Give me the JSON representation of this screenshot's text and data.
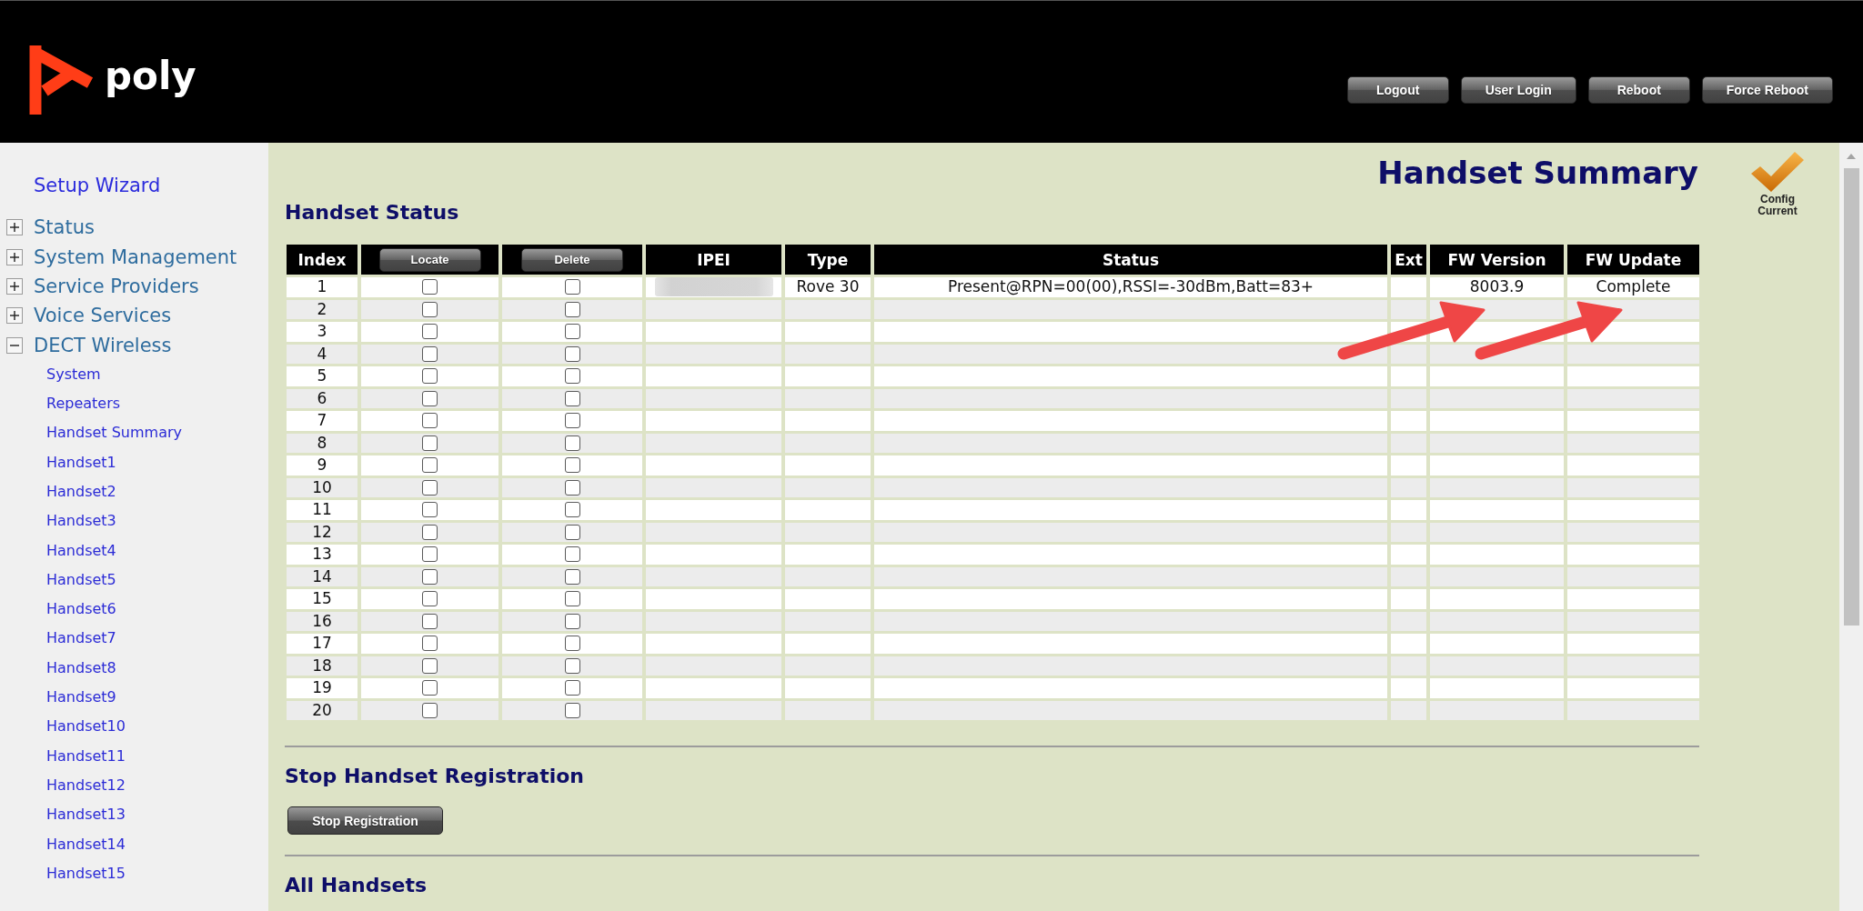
{
  "header": {
    "logo_text": "poly",
    "buttons": [
      "Logout",
      "User Login",
      "Reboot",
      "Force Reboot"
    ]
  },
  "sidebar": {
    "top_link": "Setup Wizard",
    "items": [
      {
        "label": "Status",
        "expanded": false
      },
      {
        "label": "System Management",
        "expanded": false
      },
      {
        "label": "Service Providers",
        "expanded": false
      },
      {
        "label": "Voice Services",
        "expanded": false
      },
      {
        "label": "DECT Wireless",
        "expanded": true,
        "children": [
          {
            "label": "System"
          },
          {
            "label": "Repeaters"
          },
          {
            "label": "Handset Summary"
          },
          {
            "label": "Handset1"
          },
          {
            "label": "Handset2"
          },
          {
            "label": "Handset3"
          },
          {
            "label": "Handset4"
          },
          {
            "label": "Handset5"
          },
          {
            "label": "Handset6"
          },
          {
            "label": "Handset7"
          },
          {
            "label": "Handset8"
          },
          {
            "label": "Handset9"
          },
          {
            "label": "Handset10"
          },
          {
            "label": "Handset11"
          },
          {
            "label": "Handset12"
          },
          {
            "label": "Handset13"
          },
          {
            "label": "Handset14"
          },
          {
            "label": "Handset15"
          }
        ]
      }
    ]
  },
  "page_title": "Handset Summary",
  "config_status": "Config Current",
  "handset_status": {
    "heading": "Handset Status",
    "columns": [
      {
        "label": "Index",
        "kind": "text",
        "marked_by_arrow": false
      },
      {
        "label": "Locate",
        "kind": "button",
        "marked_by_arrow": false
      },
      {
        "label": "Delete",
        "kind": "button",
        "marked_by_arrow": false
      },
      {
        "label": "IPEI",
        "kind": "text",
        "marked_by_arrow": false
      },
      {
        "label": "Type",
        "kind": "text",
        "marked_by_arrow": false
      },
      {
        "label": "Status",
        "kind": "text",
        "marked_by_arrow": false
      },
      {
        "label": "Ext",
        "kind": "text",
        "marked_by_arrow": false
      },
      {
        "label": "FW Version",
        "kind": "text",
        "marked_by_arrow": true
      },
      {
        "label": "FW Update",
        "kind": "text",
        "marked_by_arrow": true
      }
    ],
    "rows": [
      {
        "index": "1",
        "locate_checked": false,
        "delete_checked": false,
        "ipei_redacted": true,
        "type": "Rove 30",
        "status": "Present@RPN=00(00),RSSI=-30dBm,Batt=83+",
        "fw_version": "8003.9",
        "fw_update": "Complete"
      },
      {
        "index": "2",
        "locate_checked": false,
        "delete_checked": false,
        "ipei_redacted": false
      },
      {
        "index": "3",
        "locate_checked": false,
        "delete_checked": false,
        "ipei_redacted": false
      },
      {
        "index": "4",
        "locate_checked": false,
        "delete_checked": false,
        "ipei_redacted": false
      },
      {
        "index": "5",
        "locate_checked": false,
        "delete_checked": false,
        "ipei_redacted": false
      },
      {
        "index": "6",
        "locate_checked": false,
        "delete_checked": false,
        "ipei_redacted": false
      },
      {
        "index": "7",
        "locate_checked": false,
        "delete_checked": false,
        "ipei_redacted": false
      },
      {
        "index": "8",
        "locate_checked": false,
        "delete_checked": false,
        "ipei_redacted": false
      },
      {
        "index": "9",
        "locate_checked": false,
        "delete_checked": false,
        "ipei_redacted": false
      },
      {
        "index": "10",
        "locate_checked": false,
        "delete_checked": false,
        "ipei_redacted": false
      },
      {
        "index": "11",
        "locate_checked": false,
        "delete_checked": false,
        "ipei_redacted": false
      },
      {
        "index": "12",
        "locate_checked": false,
        "delete_checked": false,
        "ipei_redacted": false
      },
      {
        "index": "13",
        "locate_checked": false,
        "delete_checked": false,
        "ipei_redacted": false
      },
      {
        "index": "14",
        "locate_checked": false,
        "delete_checked": false,
        "ipei_redacted": false
      },
      {
        "index": "15",
        "locate_checked": false,
        "delete_checked": false,
        "ipei_redacted": false
      },
      {
        "index": "16",
        "locate_checked": false,
        "delete_checked": false,
        "ipei_redacted": false
      },
      {
        "index": "17",
        "locate_checked": false,
        "delete_checked": false,
        "ipei_redacted": false
      },
      {
        "index": "18",
        "locate_checked": false,
        "delete_checked": false,
        "ipei_redacted": false
      },
      {
        "index": "19",
        "locate_checked": false,
        "delete_checked": false,
        "ipei_redacted": false
      },
      {
        "index": "20",
        "locate_checked": false,
        "delete_checked": false,
        "ipei_redacted": false
      }
    ]
  },
  "stop_registration": {
    "heading": "Stop Handset Registration",
    "button": "Stop Registration"
  },
  "all_handsets": {
    "heading": "All Handsets"
  }
}
